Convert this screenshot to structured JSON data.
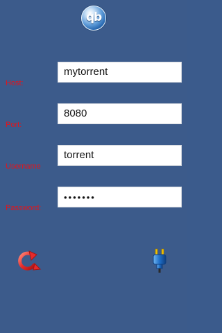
{
  "app": {
    "logo_text": "qb"
  },
  "form": {
    "host_label": "Host:",
    "host_value": "mytorrent",
    "port_label": "Port:",
    "port_value": "8080",
    "username_label": "Username",
    "username_value": "torrent",
    "password_label": "Password:",
    "password_masked": "•••••••"
  },
  "actions": {
    "refresh_icon": "refresh-icon",
    "connect_icon": "plug-icon"
  },
  "colors": {
    "background": "#3c5b8b",
    "label_red": "#e3141b",
    "accent_blue": "#1f5fa8",
    "refresh_red": "#e52b2b"
  }
}
